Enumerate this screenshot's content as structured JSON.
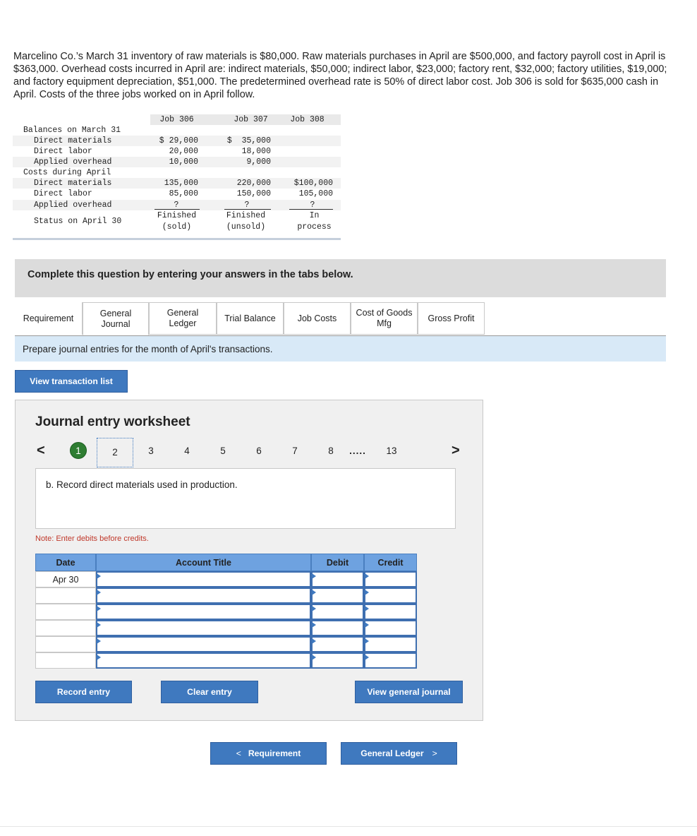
{
  "problem": {
    "text": "Marcelino Co.’s March 31 inventory of raw materials is $80,000. Raw materials purchases in April are $500,000, and factory payroll cost in April is $363,000. Overhead costs incurred in April are: indirect materials, $50,000; indirect labor, $23,000; factory rent, $32,000; factory utilities, $19,000; and factory equipment depreciation, $51,000. The predetermined overhead rate is 50% of direct labor cost. Job 306 is sold for $635,000 cash in April. Costs of the three jobs worked on in April follow."
  },
  "job_table": {
    "headers": [
      "Job 306",
      "Job 307",
      "Job 308"
    ],
    "section1": "Balances on March 31",
    "section2": "Costs during April",
    "rows": {
      "dm1": {
        "label": "Direct materials",
        "v306": "$ 29,000",
        "v307": "$  35,000",
        "v308": ""
      },
      "dl1": {
        "label": "Direct labor",
        "v306": "20,000",
        "v307": "18,000",
        "v308": ""
      },
      "oh1": {
        "label": "Applied overhead",
        "v306": "10,000",
        "v307": "9,000",
        "v308": ""
      },
      "dm2": {
        "label": "Direct materials",
        "v306": "135,000",
        "v307": "220,000",
        "v308": "$100,000"
      },
      "dl2": {
        "label": "Direct labor",
        "v306": "85,000",
        "v307": "150,000",
        "v308": "105,000"
      },
      "oh2": {
        "label": "Applied overhead",
        "v306": "?",
        "v307": "?",
        "v308": "?"
      }
    },
    "status_label": "Status on April 30",
    "status": {
      "s306a": "Finished",
      "s306b": "(sold)",
      "s307a": "Finished",
      "s307b": "(unsold)",
      "s308a": "In",
      "s308b": "process"
    }
  },
  "instructions": "Complete this question by entering your answers in the tabs below.",
  "tabs": {
    "requirement": "Requirement",
    "general_journal_1": "General",
    "general_journal_2": "Journal",
    "general_ledger_1": "General",
    "general_ledger_2": "Ledger",
    "trial_balance": "Trial Balance",
    "job_costs": "Job Costs",
    "cogm_1": "Cost of Goods",
    "cogm_2": "Mfg",
    "gross_profit": "Gross Profit"
  },
  "tab_instruction": "Prepare journal entries for the month of April's transactions.",
  "view_transaction_list": "View transaction list",
  "worksheet": {
    "title": "Journal entry worksheet",
    "pages": [
      "1",
      "2",
      "3",
      "4",
      "5",
      "6",
      "7",
      "8",
      ".....",
      "13"
    ],
    "prev_arrow": "<",
    "next_arrow": ">",
    "description": "b. Record direct materials used in production.",
    "note": "Note: Enter debits before credits.",
    "columns": {
      "date": "Date",
      "account": "Account Title",
      "debit": "Debit",
      "credit": "Credit"
    },
    "first_date": "Apr 30",
    "record_entry": "Record entry",
    "clear_entry": "Clear entry",
    "view_general_journal": "View general journal"
  },
  "nav": {
    "prev_label": "Requirement",
    "prev_glyph": "<",
    "next_label": "General Ledger",
    "next_glyph": ">"
  },
  "colors": {
    "button_blue": "#3f79bf",
    "header_blue": "#6ea2e0",
    "tab_instr_bg": "#d8e9f7",
    "done_green": "#2e7d32",
    "note_red": "#c0392b"
  }
}
